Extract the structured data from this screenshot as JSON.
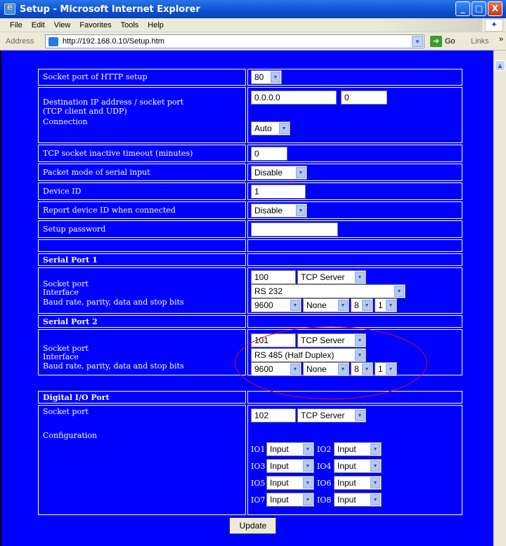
{
  "window": {
    "title": "Setup - Microsoft Internet Explorer",
    "min": "_",
    "max": "□",
    "close": "X"
  },
  "menu": [
    "File",
    "Edit",
    "View",
    "Favorites",
    "Tools",
    "Help"
  ],
  "address": {
    "label": "Address",
    "url": "http://192.168.0.10/Setup.htm",
    "go": "Go",
    "links": "Links",
    "more": "»"
  },
  "rows": {
    "http_port": {
      "label": "Socket port of HTTP setup",
      "value": "80"
    },
    "dest": {
      "label1": "Destination IP address / socket port",
      "label2": "(TCP client and UDP)",
      "label3": "Connection",
      "ip": "0.0.0.0",
      "port": "0",
      "connection": "Auto"
    },
    "timeout": {
      "label": "TCP socket inactive timeout (minutes)",
      "value": "0"
    },
    "packet": {
      "label": "Packet mode of serial input",
      "value": "Disable"
    },
    "device": {
      "label": "Device ID",
      "value": "1"
    },
    "report": {
      "label": "Report device ID when connected",
      "value": "Disable"
    },
    "password": {
      "label": "Setup password",
      "value": ""
    }
  },
  "serial1": {
    "title": "Serial Port 1",
    "l1": "Socket port",
    "l2": "Interface",
    "l3": "Baud rate, parity, data and stop bits",
    "port": "100",
    "mode": "TCP Server",
    "interface": "RS 232",
    "baud": "9600",
    "parity": "None",
    "data": "8",
    "stop": "1"
  },
  "serial2": {
    "title": "Serial Port 2",
    "l1": "Socket port",
    "l2": "Interface",
    "l3": "Baud rate, parity, data and stop bits",
    "port": "101",
    "mode": "TCP Server",
    "interface": "RS 485 (Half Duplex)",
    "baud": "9600",
    "parity": "None",
    "data": "8",
    "stop": "1"
  },
  "dio": {
    "title": "Digital I/O Port",
    "l1": "Socket port",
    "l2": "Configuration",
    "port": "102",
    "mode": "TCP Server",
    "io": [
      {
        "name": "IO1",
        "value": "Input"
      },
      {
        "name": "IO2",
        "value": "Input"
      },
      {
        "name": "IO3",
        "value": "Input"
      },
      {
        "name": "IO4",
        "value": "Input"
      },
      {
        "name": "IO5",
        "value": "Input"
      },
      {
        "name": "IO6",
        "value": "Input"
      },
      {
        "name": "IO7",
        "value": "Input"
      },
      {
        "name": "IO8",
        "value": "Input"
      }
    ]
  },
  "update": "Update",
  "colors": {
    "page_bg": "#0000ff",
    "text": "#ffffff",
    "highlight": "#e01010"
  },
  "icons": {
    "dropdown": "chevron-down-icon",
    "ie": "ie-icon",
    "go": "go-arrow-icon"
  }
}
